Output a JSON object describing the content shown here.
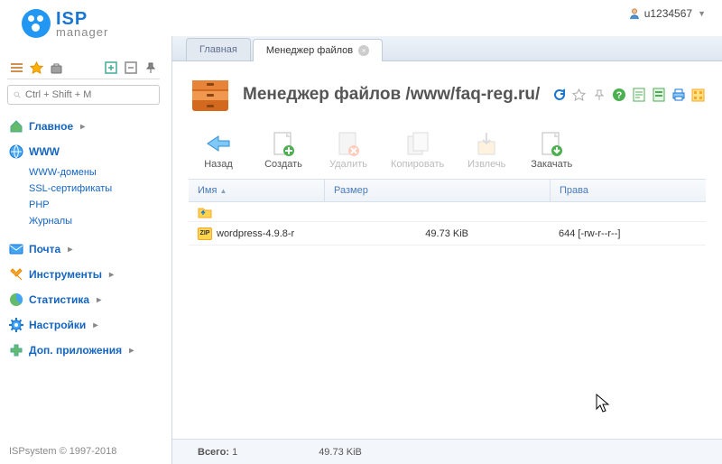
{
  "user": {
    "name": "u1234567"
  },
  "logo": {
    "top": "ISP",
    "bottom": "manager"
  },
  "search": {
    "placeholder": "Ctrl + Shift + M"
  },
  "nav": {
    "main": "Главное",
    "www": "WWW",
    "www_sub": {
      "domains": "WWW-домены",
      "ssl": "SSL-сертификаты",
      "php": "PHP",
      "logs": "Журналы"
    },
    "mail": "Почта",
    "tools": "Инструменты",
    "stats": "Статистика",
    "settings": "Настройки",
    "addons": "Доп. приложения"
  },
  "footer": "ISPsystem © 1997-2018",
  "tabs": {
    "home": "Главная",
    "fm": "Менеджер файлов"
  },
  "page_title": "Менеджер файлов /www/faq-reg.ru/",
  "actions": {
    "back": "Назад",
    "create": "Создать",
    "delete": "Удалить",
    "copy": "Копировать",
    "extract": "Извлечь",
    "download": "Закачать"
  },
  "columns": {
    "name": "Имя",
    "size": "Размер",
    "perms": "Права"
  },
  "files": [
    {
      "name": "wordpress-4.9.8-r",
      "size": "49.73 KiB",
      "perms": "644 [-rw-r--r--]"
    }
  ],
  "status": {
    "total_label": "Всего:",
    "total_count": "1",
    "total_size": "49.73 KiB"
  }
}
